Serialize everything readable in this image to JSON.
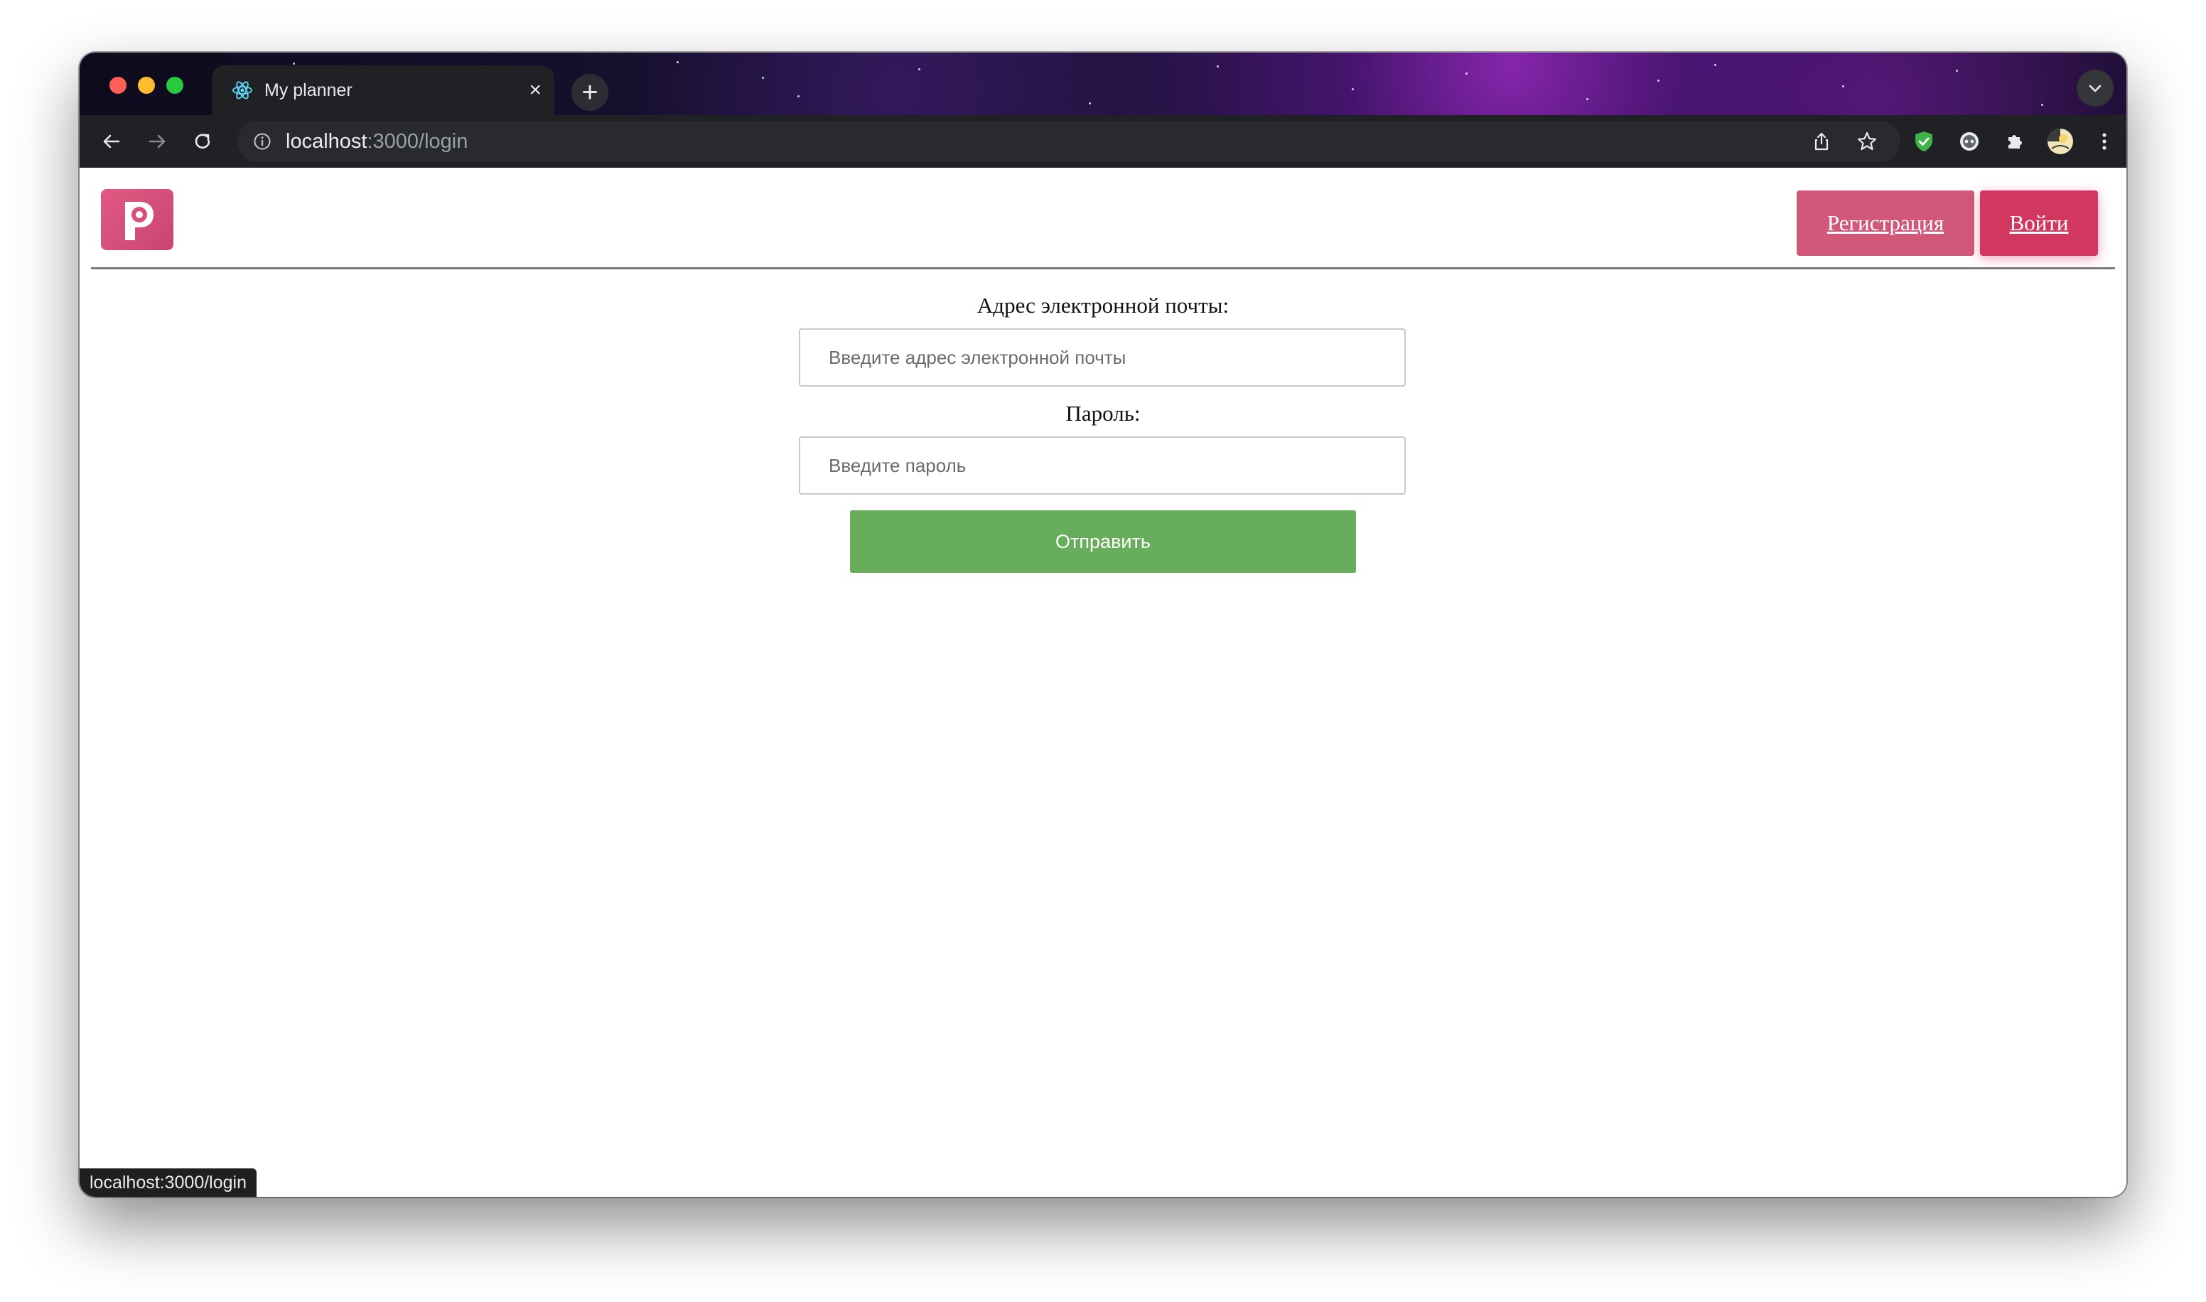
{
  "browser": {
    "tab": {
      "title": "My planner",
      "close_icon": "×"
    },
    "new_tab_icon": "+",
    "address": {
      "host": "localhost",
      "path": ":3000/login"
    },
    "toolbar_icons": [
      "share-icon",
      "bookmark-star-icon",
      "adblock-shield-icon",
      "extension-icon-2",
      "puzzle-extensions-icon",
      "profile-avatar-icon",
      "more-menu-icon"
    ]
  },
  "header": {
    "register_label": "Регистрация",
    "login_label": "Войти",
    "colors": {
      "register": "#d1587a",
      "login": "#d2385f",
      "logo": "#d94f79"
    }
  },
  "form": {
    "email_label": "Адрес электронной почты:",
    "email_placeholder": "Введите адрес электронной почты",
    "password_label": "Пароль:",
    "password_placeholder": "Введите пароль",
    "submit_label": "Отправить",
    "submit_color": "#68ad5c"
  },
  "status_bar": {
    "text": "localhost:3000/login"
  }
}
